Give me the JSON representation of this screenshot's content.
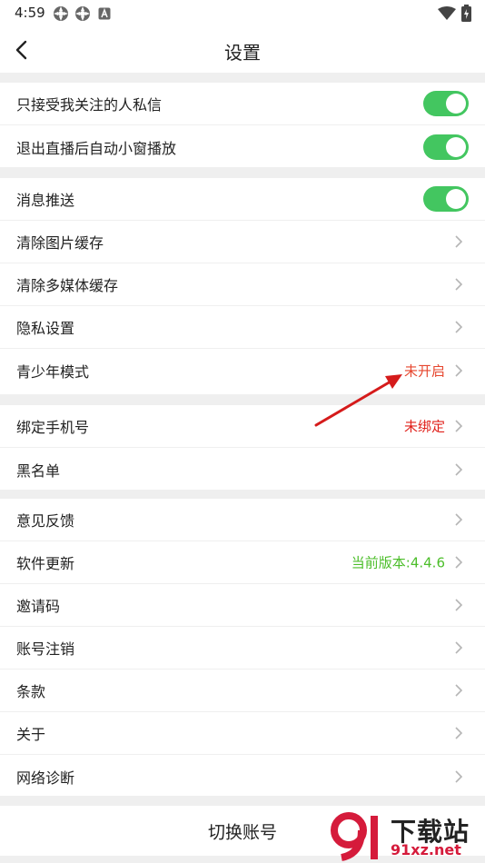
{
  "status_bar": {
    "time": "4:59"
  },
  "nav": {
    "title": "设置"
  },
  "groups": [
    {
      "rows": [
        {
          "label": "只接受我关注的人私信",
          "toggle": true
        },
        {
          "label": "退出直播后自动小窗播放",
          "toggle": true
        }
      ]
    },
    {
      "rows": [
        {
          "label": "消息推送",
          "toggle": true
        },
        {
          "label": "清除图片缓存"
        },
        {
          "label": "清除多媒体缓存"
        },
        {
          "label": "隐私设置"
        },
        {
          "label": "青少年模式",
          "value": "未开启",
          "value_color": "#e6462e"
        }
      ]
    },
    {
      "rows": [
        {
          "label": "绑定手机号",
          "value": "未绑定",
          "value_color": "#e0201a"
        },
        {
          "label": "黑名单"
        }
      ]
    },
    {
      "rows": [
        {
          "label": "意见反馈"
        },
        {
          "label": "软件更新",
          "value": "当前版本:4.4.6",
          "value_color": "#4cbe2a"
        },
        {
          "label": "邀请码"
        },
        {
          "label": "账号注销"
        },
        {
          "label": "条款"
        },
        {
          "label": "关于"
        },
        {
          "label": "网络诊断"
        }
      ]
    }
  ],
  "footer": {
    "switch_account": "切换账号"
  },
  "watermark": {
    "cn": "下载站",
    "en": "91xz.net"
  },
  "colors": {
    "toggle_on": "#43c660",
    "accent_red": "#d51b3b",
    "page_bg": "#efefef"
  }
}
